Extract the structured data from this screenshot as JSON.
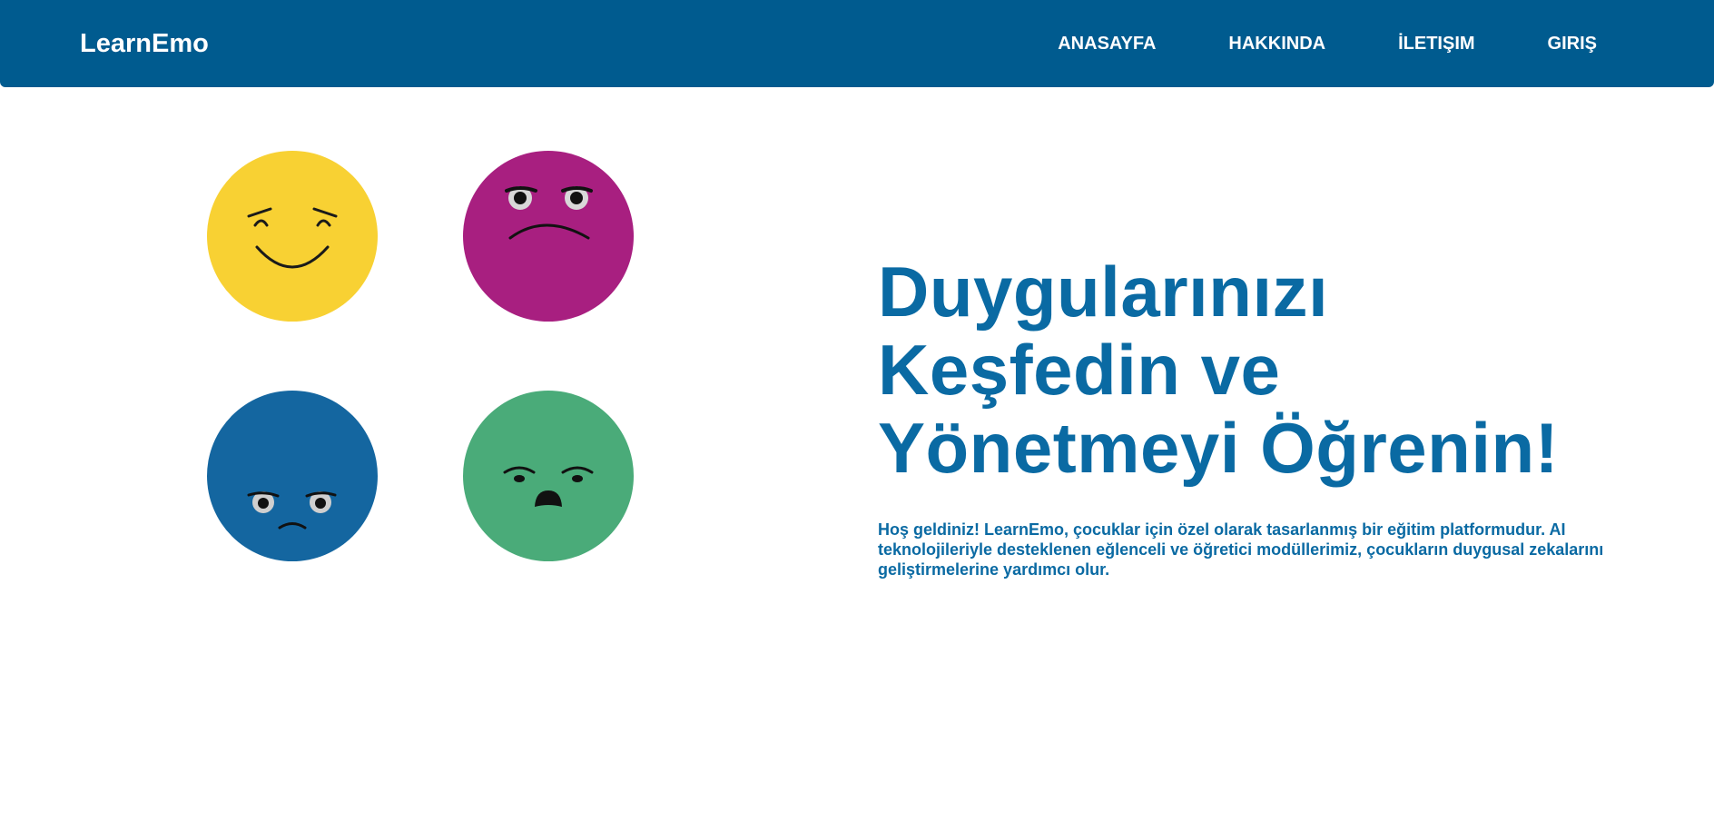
{
  "header": {
    "brand": "LearnEmo",
    "nav": [
      {
        "label": "ANASAYFA"
      },
      {
        "label": "HAKKINDA"
      },
      {
        "label": "İLETIŞIM"
      },
      {
        "label": "GIRIŞ"
      }
    ]
  },
  "hero": {
    "title_lines": [
      "Duygularınızı",
      "Keşfedin ve",
      "Yönetmeyi Öğrenin!"
    ],
    "description": "Hoş geldiniz! LearnEmo, çocuklar için özel olarak tasarlanmış bir eğitim platformudur. AI teknolojileriyle desteklenen eğlenceli ve öğretici modüllerimiz, çocukların duygusal zekalarını geliştirmelerine yardımcı olur."
  },
  "emotions": [
    {
      "name": "happy",
      "color": "#f8d133"
    },
    {
      "name": "angry",
      "color": "#a81f80"
    },
    {
      "name": "sad",
      "color": "#1466a0"
    },
    {
      "name": "surprised",
      "color": "#4aab79"
    }
  ],
  "colors": {
    "nav_background": "#005b8f",
    "accent_text": "#0a6aa3",
    "nav_text": "#ffffff"
  }
}
